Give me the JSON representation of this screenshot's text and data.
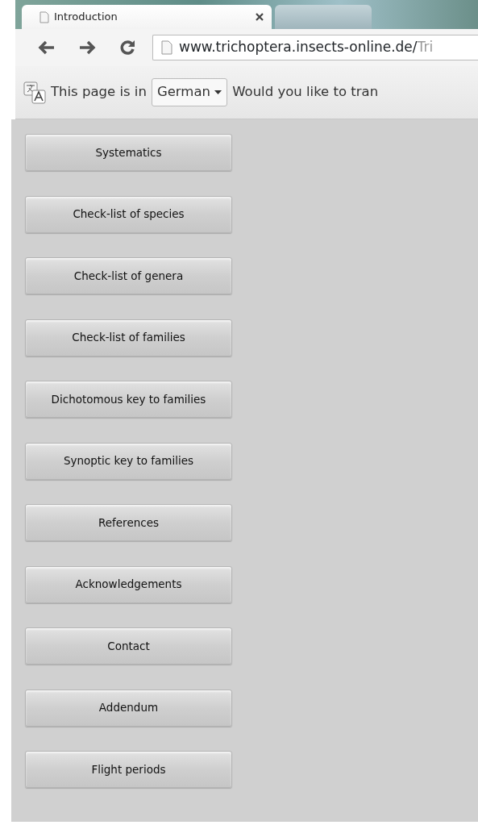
{
  "tabs": [
    {
      "title": "Introduction",
      "selected": true
    },
    {
      "selected": false
    }
  ],
  "address_bar": {
    "host": "www.trichoptera.insects-online.de/",
    "path": "Tri"
  },
  "translate_bar": {
    "prefix": "This page is in",
    "language": "German",
    "question": "Would you like to tran"
  },
  "menu_buttons": [
    {
      "label": "Systematics"
    },
    {
      "label": "Check-list of species"
    },
    {
      "label": "Check-list of genera"
    },
    {
      "label": "Check-list of families"
    },
    {
      "label": "Dichotomous key to families"
    },
    {
      "label": "Synoptic key to families"
    },
    {
      "label": "References"
    },
    {
      "label": "Acknowledgements"
    },
    {
      "label": "Contact"
    },
    {
      "label": "Addendum"
    },
    {
      "label": "Flight periods"
    }
  ]
}
